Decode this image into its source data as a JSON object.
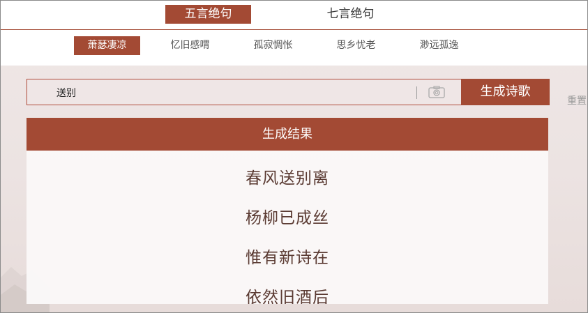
{
  "tabs": [
    {
      "label": "五言绝句",
      "active": true
    },
    {
      "label": "七言绝句",
      "active": false
    }
  ],
  "categories": [
    {
      "label": "萧瑟凄凉",
      "active": true
    },
    {
      "label": "忆旧感喟",
      "active": false
    },
    {
      "label": "孤寂惆怅",
      "active": false
    },
    {
      "label": "思乡忧老",
      "active": false
    },
    {
      "label": "渺远孤逸",
      "active": false
    }
  ],
  "search": {
    "value": "送别",
    "camera_icon": "camera-icon",
    "generate_label": "生成诗歌"
  },
  "reset_label": "重置",
  "result": {
    "title": "生成结果",
    "lines": [
      "春风送别离",
      "杨柳已成丝",
      "惟有新诗在",
      "依然旧酒后"
    ]
  },
  "colors": {
    "accent": "#a34a34",
    "background": "#ece3e2"
  }
}
